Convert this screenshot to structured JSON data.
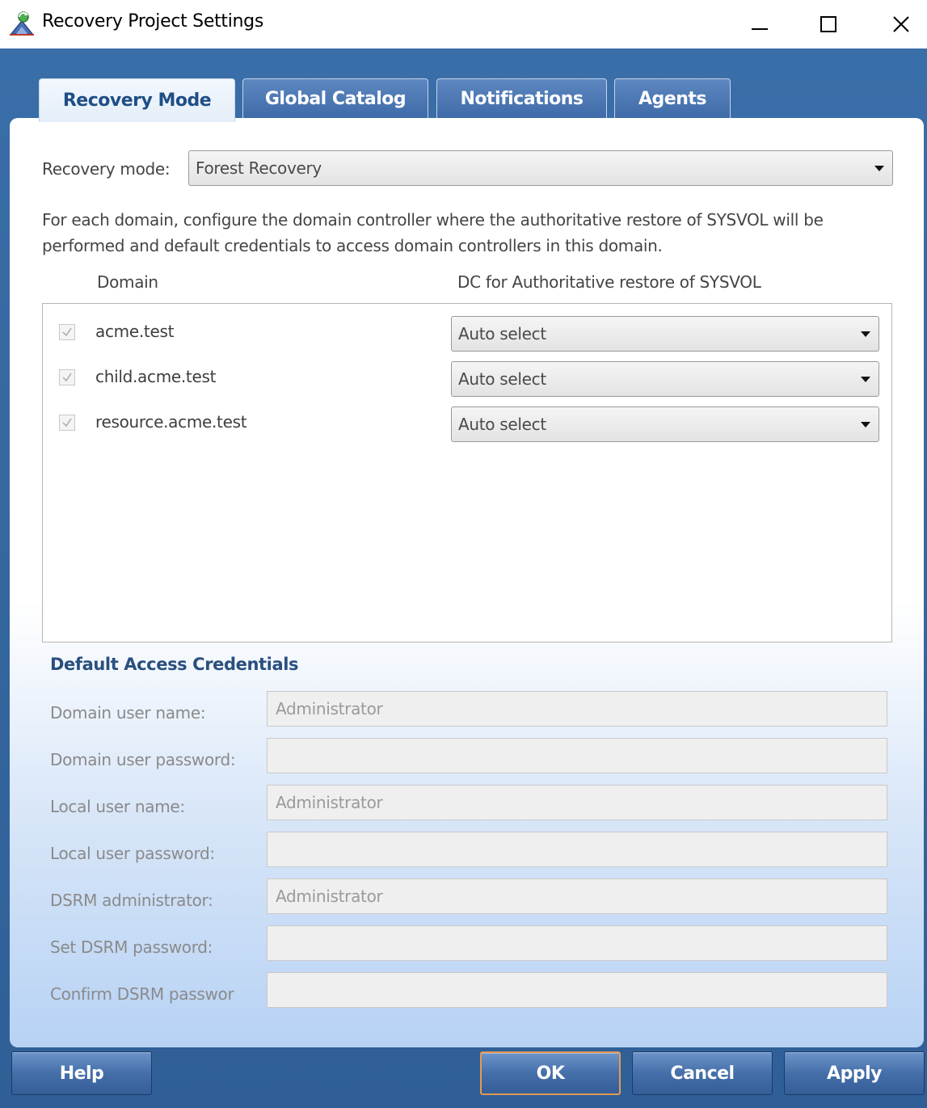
{
  "window": {
    "title": "Recovery Project Settings",
    "icon": "recovery-manager-app-icon",
    "controls": [
      "minimize-icon",
      "maximize-icon",
      "close-icon"
    ]
  },
  "tabs": [
    {
      "label": "Recovery Mode",
      "active": true
    },
    {
      "label": "Global Catalog",
      "active": false
    },
    {
      "label": "Notifications",
      "active": false
    },
    {
      "label": "Agents",
      "active": false
    }
  ],
  "recovery_mode": {
    "label": "Recovery mode:",
    "value": "Forest Recovery"
  },
  "description": "For each domain, configure the domain controller where the authoritative restore of SYSVOL will be performed and default credentials to access domain controllers in this domain.",
  "domain_table": {
    "headers": {
      "domain": "Domain",
      "dc": "DC for Authoritative restore of SYSVOL"
    },
    "rows": [
      {
        "domain": "acme.test",
        "checked": true,
        "dc": "Auto select"
      },
      {
        "domain": "child.acme.test",
        "checked": true,
        "dc": "Auto select"
      },
      {
        "domain": "resource.acme.test",
        "checked": true,
        "dc": "Auto select"
      }
    ]
  },
  "credentials": {
    "title": "Default Access Credentials",
    "fields": [
      {
        "label": "Domain user name:",
        "value": "Administrator"
      },
      {
        "label": "Domain user password:",
        "value": ""
      },
      {
        "label": "Local user name:",
        "value": "Administrator"
      },
      {
        "label": "Local user password:",
        "value": ""
      },
      {
        "label": "DSRM administrator:",
        "value": "Administrator"
      },
      {
        "label": "Set DSRM password:",
        "value": ""
      },
      {
        "label": "Confirm DSRM passwor",
        "value": ""
      }
    ]
  },
  "buttons": {
    "help": "Help",
    "ok": "OK",
    "cancel": "Cancel",
    "apply": "Apply"
  },
  "colors": {
    "dialog_bg": "#3a6ea8",
    "tab_active_text": "#1f4e86",
    "button_bg": "#456fa9",
    "ok_focus_border": "#e39a52",
    "section_title": "#2a4f7e"
  }
}
